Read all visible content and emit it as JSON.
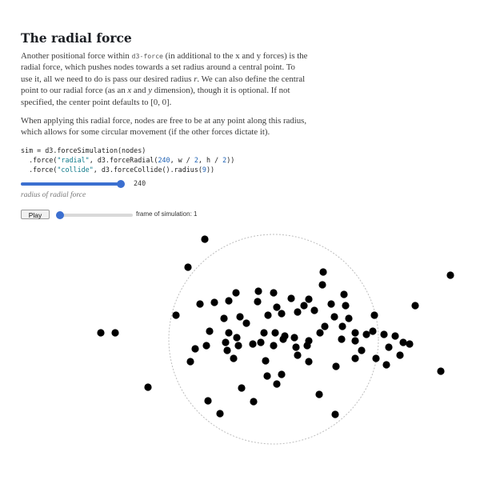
{
  "article": {
    "title": "The radial force",
    "p1_a": "Another positional force within ",
    "p1_code": "d3-force",
    "p1_b": " (in additional to the x and y forces) is the radial force, which pushes nodes towards a set radius around a central point. To use it, all we need to do is pass our desired radius ",
    "p1_r": "r",
    "p1_c": ". We can also define the central point to our radial force (as an ",
    "p1_x": "x",
    "p1_d": " and ",
    "p1_y": "y",
    "p1_e": " dimension), though it is optional. If not specified, the center point defaults to [0, 0].",
    "p2": "When applying this radial force, nodes are free to be at any point along this radius, which allows for some circular movement (if the other forces dictate it).",
    "code": {
      "l1": "sim = d3.forceSimulation(nodes)",
      "l2_a": "  .force(",
      "l2_str": "\"radial\"",
      "l2_b": ", d3.forceRadial(",
      "l2_num": "240",
      "l2_c": ", w / ",
      "l2_num2": "2",
      "l2_d": ", h / ",
      "l2_num3": "2",
      "l2_e": "))",
      "l3_a": "  .force(",
      "l3_str": "\"collide\"",
      "l3_b": ", d3.forceCollide().radius(",
      "l3_num": "9",
      "l3_c": "))"
    }
  },
  "radius_slider": {
    "value": 240,
    "label": "240",
    "min": 0,
    "max": 250,
    "caption": "radius of radial force"
  },
  "simulation_controls": {
    "play_label": "Play",
    "frame_min": 1,
    "frame_max": 300,
    "frame_value": 1,
    "frame_label": "frame of simulation: 1"
  },
  "colors": {
    "accent": "#3b6fd0",
    "node": "#000000",
    "ring": "#bdbdbd"
  }
}
